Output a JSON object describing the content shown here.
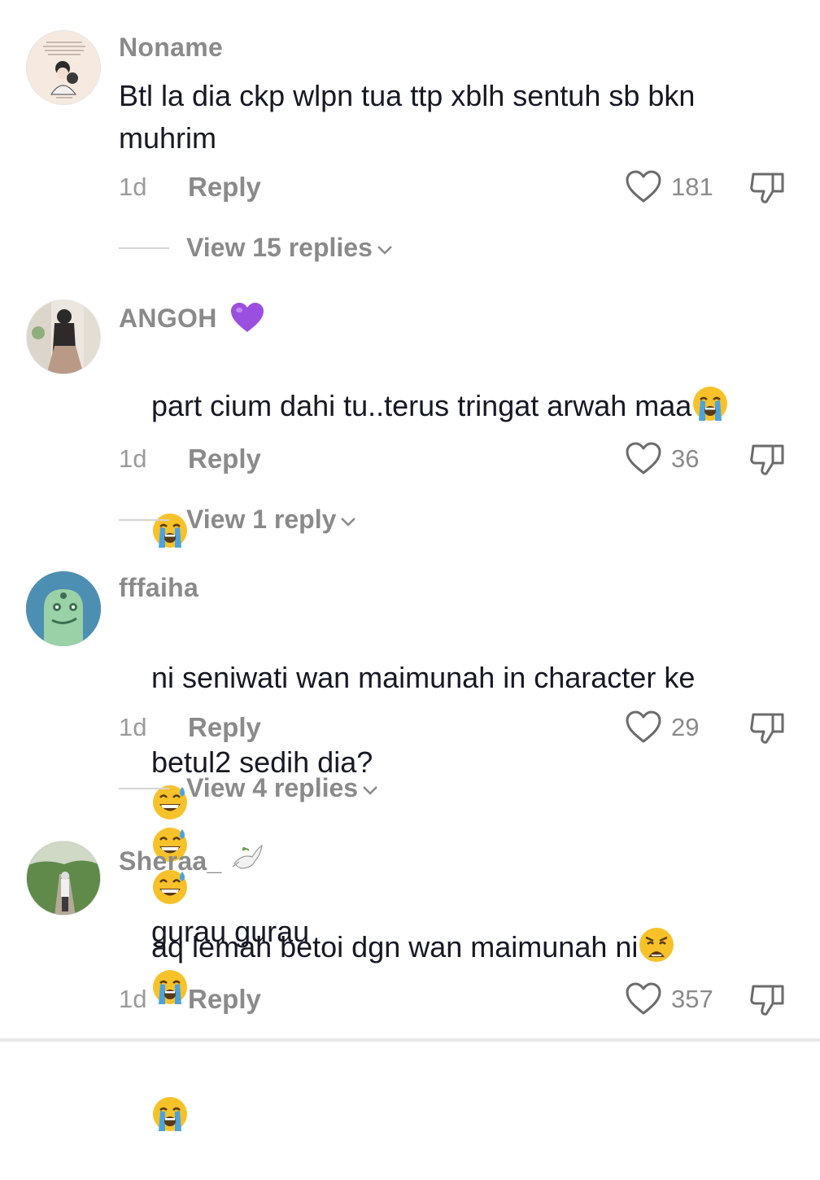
{
  "comments": [
    {
      "username": "Noname",
      "body": "Btl la dia ckp wlpn tua ttp xblh sentuh sb bkn\nmuhrim",
      "time": "1d",
      "reply_label": "Reply",
      "likes": "181",
      "view_replies": "View 15 replies"
    },
    {
      "username": "ANGOH",
      "username_emoji": "purple-heart-emoji",
      "body_line1": "part cium dahi tu..terus tringat arwah maa",
      "body_emoji": "loudly-crying-face-emoji",
      "time": "1d",
      "reply_label": "Reply",
      "likes": "36",
      "view_replies": "View 1 reply"
    },
    {
      "username": "fffaiha",
      "body_line1": "ni seniwati wan maimunah in character ke",
      "body_line2_start": "betul2 sedih dia?",
      "body_line2_end": "gurau gurau",
      "body_emoji": "grinning-face-with-sweat-emoji",
      "time": "1d",
      "reply_label": "Reply",
      "likes": "29",
      "view_replies": "View 4 replies"
    },
    {
      "username": "Sheraa_",
      "username_emoji": "dove-emoji",
      "body_line1": "aq lemah betoi dgn wan maimunah ni",
      "body_emoji": [
        "weary-face-emoji",
        "loudly-crying-face-emoji"
      ],
      "time": "1d",
      "reply_label": "Reply",
      "likes": "357"
    }
  ],
  "colors": {
    "text": "#161823",
    "muted": "#8a8a8a",
    "emoji_yellow": "#f7c229",
    "tear_blue": "#4aa3e0",
    "purple_heart": "#9b4fe0"
  }
}
